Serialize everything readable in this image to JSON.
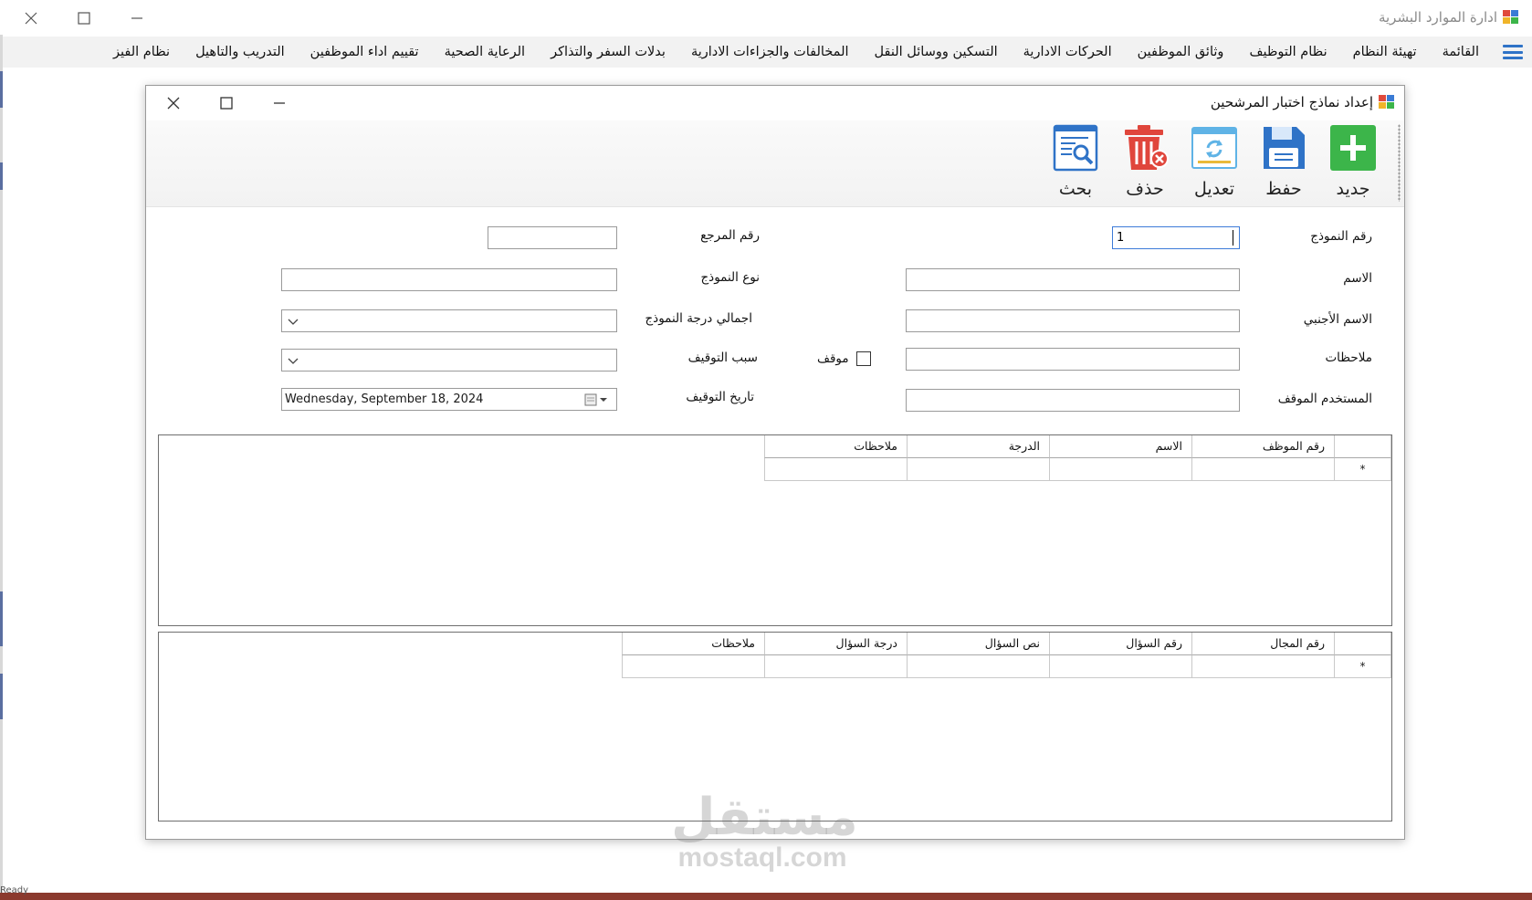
{
  "app": {
    "title": "ادارة الموارد البشرية",
    "menu": [
      "القائمة",
      "تهيئة النظام",
      "نظام التوظيف",
      "وثائق الموظفين",
      "الحركات الادارية",
      "التسكين ووسائل النقل",
      "المخالفات والجزاءات الادارية",
      "بدلات السفر والتذاكر",
      "الرعاية الصحية",
      "تقييم اداء الموظفين",
      "التدريب والتاهيل",
      "نظام الفيز"
    ],
    "status_text": "Ready",
    "colors": {
      "menu_icon": "#2f73c7",
      "statusbar": "#8b3a2e"
    }
  },
  "child": {
    "title": "إعداد نماذج اختبار المرشحين",
    "toolbar": {
      "new": {
        "label": "جديد",
        "icon": "plus-icon",
        "color": "#3cb54a"
      },
      "save": {
        "label": "حفظ",
        "icon": "floppy-disk-icon",
        "color": "#2f73c7"
      },
      "edit": {
        "label": "تعديل",
        "icon": "refresh-window-icon",
        "color": "#5fb3e6"
      },
      "delete": {
        "label": "حذف",
        "icon": "trash-icon",
        "color": "#e0463c"
      },
      "search": {
        "label": "بحث",
        "icon": "document-search-icon",
        "color": "#2f73c7"
      }
    },
    "form": {
      "model_number": {
        "label": "رقم النموذج",
        "value": "1"
      },
      "name": {
        "label": "الاسم",
        "value": ""
      },
      "foreign_name": {
        "label": "الاسم الأجنبي",
        "value": ""
      },
      "notes": {
        "label": "ملاحظات",
        "value": ""
      },
      "stopping_user": {
        "label": "المستخدم الموقف",
        "value": ""
      },
      "reference_number": {
        "label": "رقم المرجع",
        "value": ""
      },
      "model_type": {
        "label": "نوع النموذج",
        "value": ""
      },
      "total_grade": {
        "label": "اجمالي درجة النموذج",
        "value": ""
      },
      "stop_reason": {
        "label": "سبب التوقيف",
        "value": ""
      },
      "stop_date": {
        "label": "تاريخ التوقيف",
        "value": "Wednesday, September 18, 2024"
      },
      "stopped": {
        "label": "موقف",
        "checked": false
      }
    },
    "grid1": {
      "columns": [
        "رقم الموظف",
        "الاسم",
        "الدرجة",
        "ملاحظات"
      ],
      "new_row_marker": "*"
    },
    "grid2": {
      "columns": [
        "رقم المجال",
        "رقم السؤال",
        "نص السؤال",
        "درجة السؤال",
        "ملاحظات"
      ],
      "new_row_marker": "*"
    }
  },
  "watermark": {
    "arabic": "مستقل",
    "latin": "mostaql.com"
  }
}
